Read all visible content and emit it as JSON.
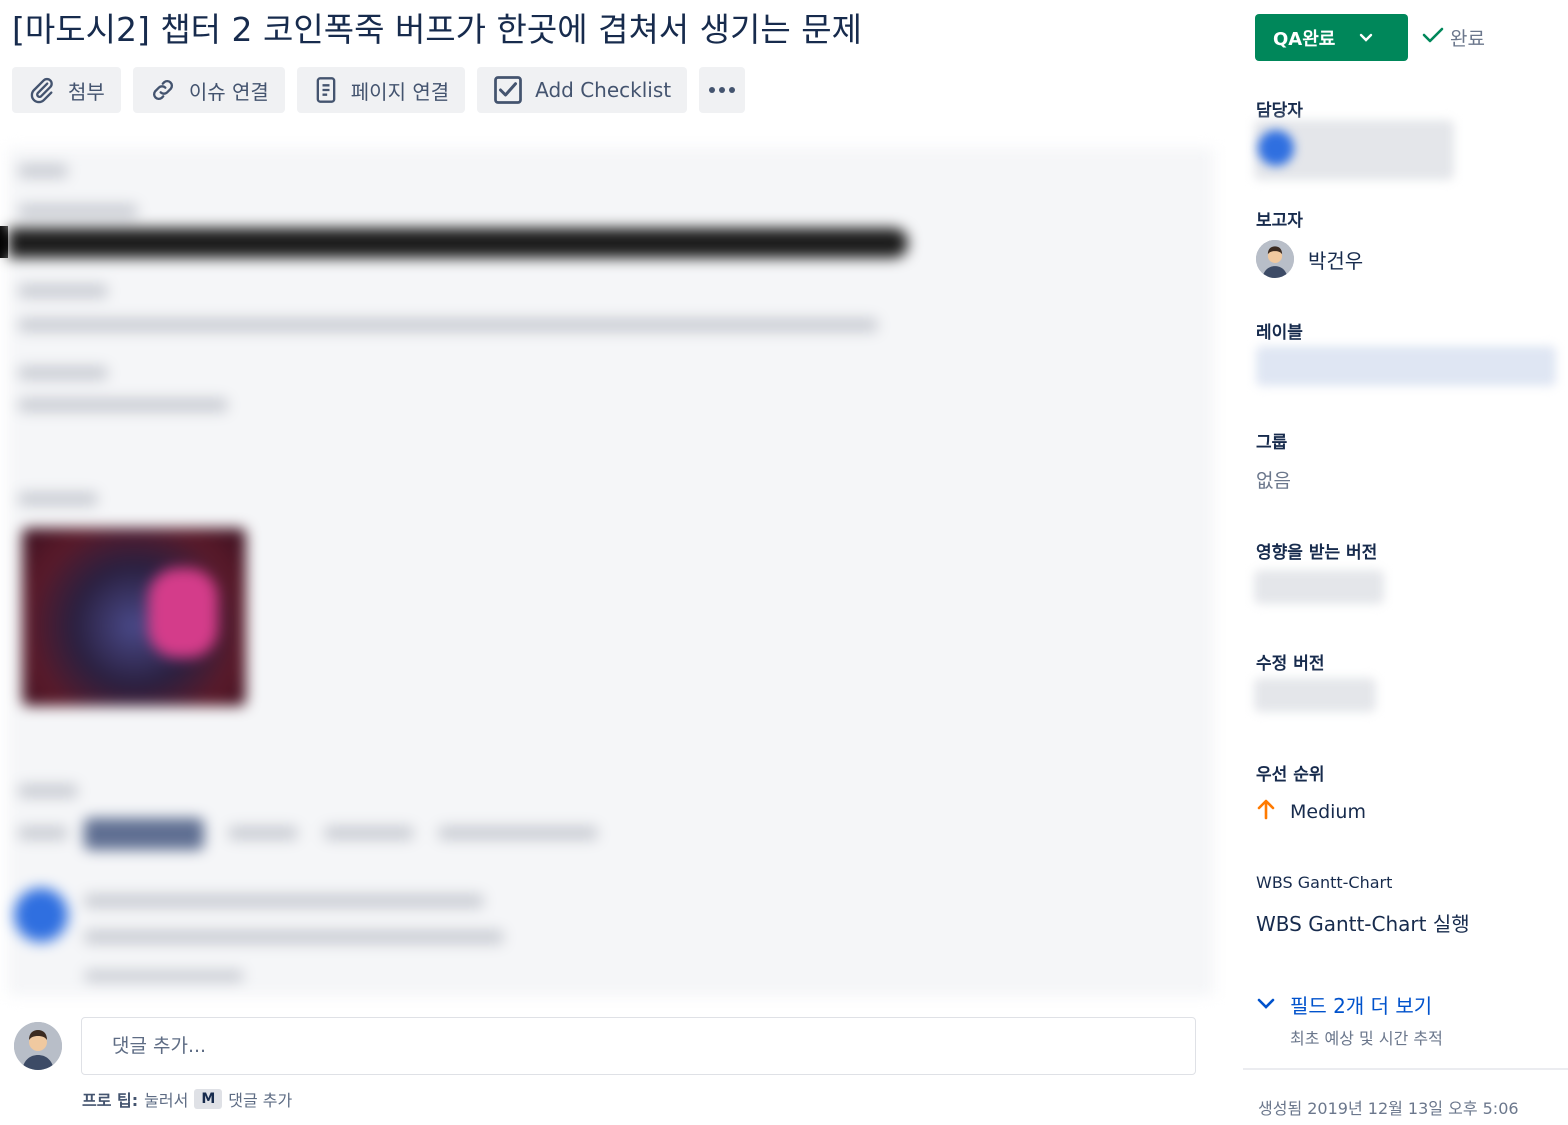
{
  "issue": {
    "title": "[마도시2] 챕터 2 코인폭죽 버프가 한곳에 겹쳐서 생기는 문제"
  },
  "toolbar": {
    "attach_label": "첨부",
    "link_issue_label": "이슈 연결",
    "link_page_label": "페이지 연결",
    "checklist_label": "Add Checklist",
    "more_icon": "more-icon"
  },
  "comment": {
    "placeholder": "댓글 추가...",
    "protip_prefix": "프로 팁:",
    "protip_press": "눌러서",
    "protip_key": "M",
    "protip_suffix": "댓글 추가"
  },
  "sidebar": {
    "status_label": "QA완료",
    "resolution_label": "완료",
    "assignee_label": "담당자",
    "reporter_label": "보고자",
    "reporter_name": "박건우",
    "labels_label": "레이블",
    "group_label": "그룹",
    "group_value": "없음",
    "affects_version_label": "영향을 받는 버전",
    "fix_version_label": "수정 버전",
    "priority_label": "우선 순위",
    "priority_value": "Medium",
    "wbs_label": "WBS Gantt-Chart",
    "wbs_link": "WBS Gantt-Chart 실행",
    "more_fields_label": "필드 2개 더 보기",
    "more_fields_sub": "최초 예상 및 시간 추적",
    "created_label": "생성됨 2019년 12월 13일 오후 5:06"
  },
  "colors": {
    "status_green": "#00875a",
    "link_blue": "#0052cc",
    "priority_orange": "#ff7a00"
  }
}
